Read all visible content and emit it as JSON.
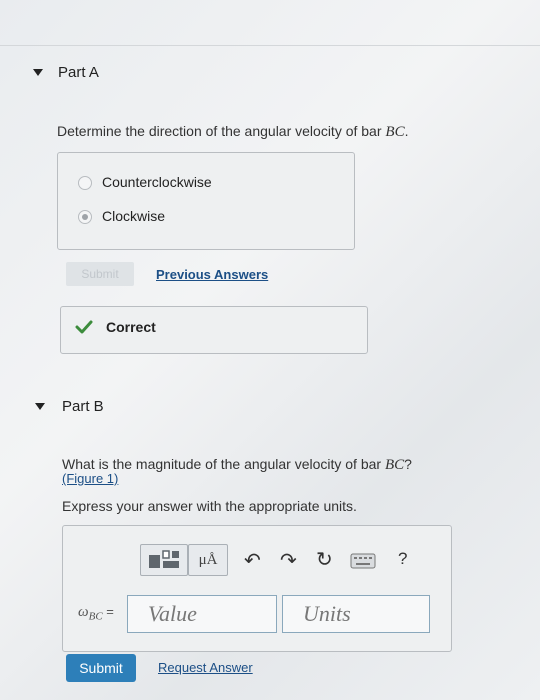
{
  "part_a": {
    "title": "Part A",
    "question": "Determine the direction of the angular velocity of bar ",
    "question_var": "BC",
    "question_end": ".",
    "options": [
      {
        "label": "Counterclockwise",
        "selected": false
      },
      {
        "label": "Clockwise",
        "selected": true
      }
    ],
    "submit_label": "Submit",
    "previous_answers_label": "Previous Answers",
    "feedback": "Correct"
  },
  "part_b": {
    "title": "Part B",
    "question": "What is the magnitude of the angular velocity of bar ",
    "question_var": "BC",
    "question_end": "?",
    "figure_link": "(Figure 1)",
    "instruction": "Express your answer with the appropriate units.",
    "toolbar": {
      "units_button": "μÅ",
      "undo": "↶",
      "redo": "↷",
      "reset": "↻",
      "help": "?"
    },
    "answer_label_symbol": "ω",
    "answer_label_sub": "BC",
    "answer_label_eq": " =",
    "value_placeholder": "Value",
    "units_placeholder": "Units",
    "submit_label": "Submit",
    "request_answer_label": "Request Answer"
  }
}
